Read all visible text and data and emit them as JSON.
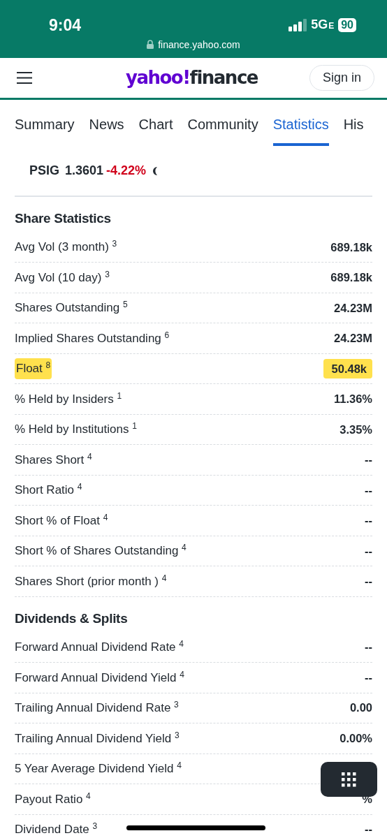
{
  "status_bar": {
    "time": "9:04",
    "network": "5G",
    "network_suffix": "E",
    "battery": "90",
    "url": "finance.yahoo.com"
  },
  "header": {
    "logo_brand": "yahoo!",
    "logo_product": "finance",
    "sign_in": "Sign in"
  },
  "tabs": [
    {
      "label": "Summary",
      "selected": false
    },
    {
      "label": "News",
      "selected": false
    },
    {
      "label": "Chart",
      "selected": false
    },
    {
      "label": "Community",
      "selected": false
    },
    {
      "label": "Statistics",
      "selected": true
    },
    {
      "label": "His",
      "selected": false
    }
  ],
  "quote": {
    "symbol": "PSIG",
    "price": "1.3601",
    "change": "-4.22%"
  },
  "sections": [
    {
      "title": "Share Statistics",
      "rows": [
        {
          "label": "Avg Vol (3 month) $^{3}$",
          "value": "689.18k",
          "highlighted": false
        },
        {
          "label": "Avg Vol (10 day) $^{3}$",
          "value": "689.18k",
          "highlighted": false
        },
        {
          "label": "Shares Outstanding $^{5}$",
          "value": "24.23M",
          "highlighted": false
        },
        {
          "label": "Implied Shares Outstanding $^{6}$",
          "value": "24.23M",
          "highlighted": false
        },
        {
          "label": "Float $^{8}$",
          "value": "50.48k",
          "highlighted": true
        },
        {
          "label": "% Held by Insiders $^{1}$",
          "value": "11.36%",
          "highlighted": false
        },
        {
          "label": "% Held by Institutions $^{1}$",
          "value": "3.35%",
          "highlighted": false
        },
        {
          "label": "Shares Short $^{4}$",
          "value": "--",
          "highlighted": false
        },
        {
          "label": "Short Ratio $^{4}$",
          "value": "--",
          "highlighted": false
        },
        {
          "label": "Short % of Float $^{4}$",
          "value": "--",
          "highlighted": false
        },
        {
          "label": "Short % of Shares Outstanding $^{4}$",
          "value": "--",
          "highlighted": false
        },
        {
          "label": "Shares Short (prior month ) $^{4}$",
          "value": "--",
          "highlighted": false
        }
      ]
    },
    {
      "title": "Dividends & Splits",
      "rows": [
        {
          "label": "Forward Annual Dividend Rate $^{4}$",
          "value": "--",
          "highlighted": false
        },
        {
          "label": "Forward Annual Dividend Yield $^{4}$",
          "value": "--",
          "highlighted": false
        },
        {
          "label": "Trailing Annual Dividend Rate $^{3}$",
          "value": "0.00",
          "highlighted": false
        },
        {
          "label": "Trailing Annual Dividend Yield $^{3}$",
          "value": "0.00%",
          "highlighted": false
        },
        {
          "label": "5 Year Average Dividend Yield $^{4}$",
          "highlighted": false
        },
        {
          "label": "Payout Ratio $^{4}$",
          "value": "%",
          "highlighted": false
        },
        {
          "label": "Dividend Date $^{3}$",
          "value": "--",
          "highlighted": false
        }
      ]
    }
  ]
}
